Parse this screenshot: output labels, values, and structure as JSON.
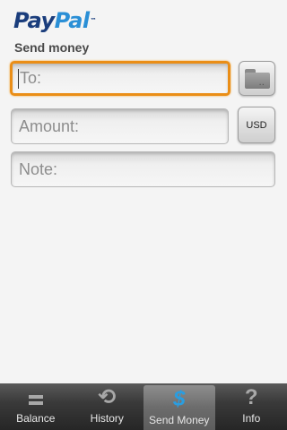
{
  "brand": {
    "pay": "Pay",
    "pal": "Pal",
    "tm": "™"
  },
  "title": "Send money",
  "form": {
    "to_placeholder": "To:",
    "amount_placeholder": "Amount:",
    "currency_label": "USD",
    "note_placeholder": "Note:"
  },
  "tabs": [
    {
      "label": "Balance",
      "icon": "balance-icon",
      "active": false
    },
    {
      "label": "History",
      "icon": "history-icon",
      "active": false
    },
    {
      "label": "Send Money",
      "icon": "dollar-icon",
      "active": true
    },
    {
      "label": "Info",
      "icon": "question-icon",
      "active": false
    }
  ],
  "colors": {
    "focus": "#ea8e17",
    "brand_dark": "#1a3d7c",
    "brand_light": "#2a8fd6",
    "active_icon": "#2a9de0"
  }
}
